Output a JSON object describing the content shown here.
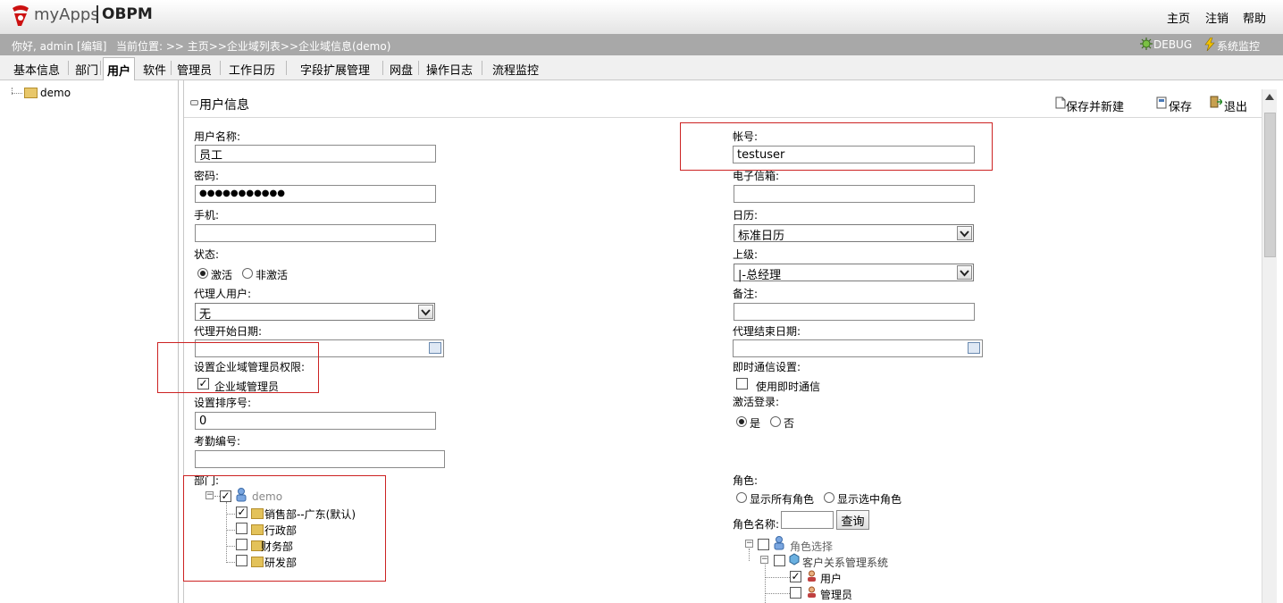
{
  "header": {
    "logo_text": "myApps",
    "product": "OBPM",
    "links": [
      "主页",
      "注销",
      "帮助"
    ]
  },
  "statusbar": {
    "greeting": "你好, admin [编辑]",
    "location": "当前位置: >> 主页>>企业域列表>>企业域信息(demo)",
    "debug": "DEBUG",
    "monitor": "系统监控"
  },
  "nav": {
    "tabs": [
      "基本信息",
      "部门",
      "用户",
      "软件",
      "管理员",
      "工作日历",
      "字段扩展管理",
      "网盘",
      "操作日志",
      "流程监控"
    ],
    "active": "用户"
  },
  "left_tree": {
    "root": "demo"
  },
  "panel": {
    "title": "用户信息",
    "save_new": "保存并新建",
    "save": "保存",
    "exit": "退出"
  },
  "form": {
    "username_label": "用户名称:",
    "username_value": "员工",
    "account_label": "帐号:",
    "account_value": "testuser",
    "password_label": "密码:",
    "password_value": "●●●●●●●●●●●",
    "email_label": "电子信箱:",
    "email_value": "",
    "mobile_label": "手机:",
    "mobile_value": "",
    "calendar_label": "日历:",
    "calendar_value": "标准日历",
    "status_label": "状态:",
    "status_active": "激活",
    "status_inactive": "非激活",
    "superior_label": "上级:",
    "superior_value": "|-总经理",
    "proxy_label": "代理人用户:",
    "proxy_value": "无",
    "remark_label": "备注:",
    "remark_value": "",
    "proxy_start_label": "代理开始日期:",
    "proxy_end_label": "代理结束日期:",
    "domain_admin_label": "设置企业域管理员权限:",
    "domain_admin_option": "企业域管理员",
    "im_label": "即时通信设置:",
    "im_option": "使用即时通信",
    "sort_label": "设置排序号:",
    "sort_value": "0",
    "activate_login_label": "激活登录:",
    "activate_yes": "是",
    "activate_no": "否",
    "attendance_label": "考勤编号:",
    "attendance_value": ""
  },
  "departments": {
    "label": "部门:",
    "root": "demo",
    "items": [
      {
        "name": "销售部--广东(默认)",
        "checked": true
      },
      {
        "name": "行政部",
        "checked": false
      },
      {
        "name": "财务部",
        "checked": false
      },
      {
        "name": "研发部",
        "checked": false
      }
    ]
  },
  "roles": {
    "label": "角色:",
    "show_all": "显示所有角色",
    "show_selected": "显示选中角色",
    "name_label": "角色名称:",
    "name_value": "",
    "query_button": "查询",
    "root": "角色选择",
    "group": "客户关系管理系统",
    "items": [
      {
        "name": "用户",
        "checked": true
      },
      {
        "name": "管理员",
        "checked": false
      }
    ]
  }
}
